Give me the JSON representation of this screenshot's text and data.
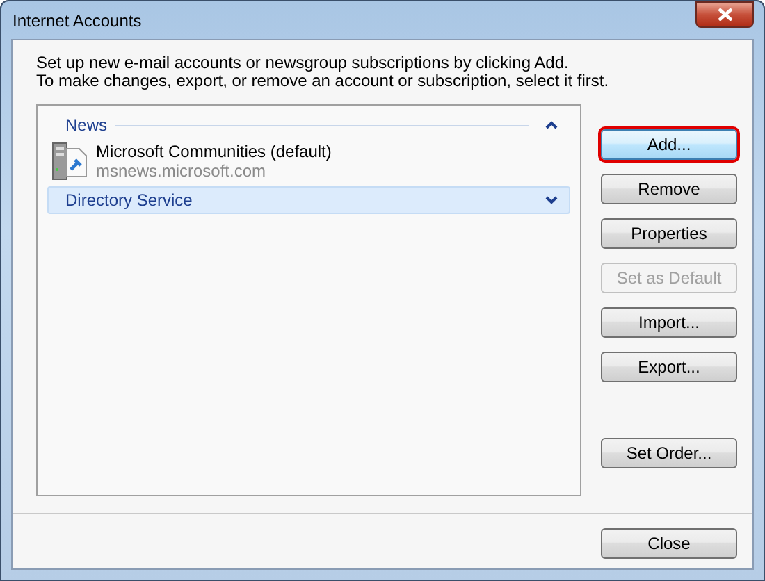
{
  "window": {
    "title": "Internet Accounts"
  },
  "instructions": [
    "Set up new e-mail accounts or newsgroup subscriptions by clicking Add.",
    "To make changes, export, or remove an account or subscription, select it first."
  ],
  "groups": [
    {
      "label": "News",
      "expanded": true,
      "selected": false,
      "accounts": [
        {
          "name": "Microsoft Communities (default)",
          "server": "msnews.microsoft.com"
        }
      ]
    },
    {
      "label": "Directory Service",
      "expanded": false,
      "selected": true
    }
  ],
  "button_groups": [
    [
      {
        "label": "Add...",
        "disabled": false,
        "highlighted": true
      },
      {
        "label": "Remove",
        "disabled": false,
        "highlighted": false
      },
      {
        "label": "Properties",
        "disabled": false,
        "highlighted": false
      },
      {
        "label": "Set as Default",
        "disabled": true,
        "highlighted": false
      },
      {
        "label": "Import...",
        "disabled": false,
        "highlighted": false
      },
      {
        "label": "Export...",
        "disabled": false,
        "highlighted": false
      }
    ],
    [
      {
        "label": "Set Order...",
        "disabled": false,
        "highlighted": false
      }
    ]
  ],
  "close_button": {
    "label": "Close"
  }
}
